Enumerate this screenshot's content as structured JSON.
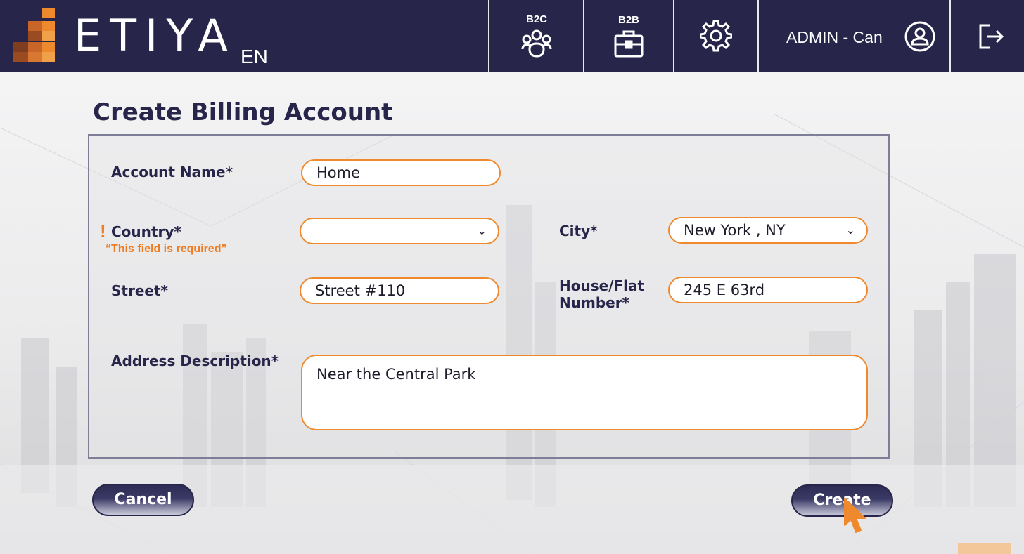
{
  "header": {
    "brand": "ETIYA",
    "language": "EN",
    "b2c_label": "B2C",
    "b2b_label": "B2B",
    "user": "ADMIN - Can",
    "icons": [
      "users-icon",
      "briefcase-icon",
      "gear-icon",
      "user-circle-icon",
      "logout-icon"
    ]
  },
  "page": {
    "title": "Create Billing Account"
  },
  "form": {
    "account_name": {
      "label": "Account Name*",
      "value": "Home"
    },
    "country": {
      "label": "Country*",
      "value": "",
      "error": "“This field is required”",
      "error_mark": "!"
    },
    "city": {
      "label": "City*",
      "value": "New York , NY"
    },
    "street": {
      "label": "Street*",
      "value": "Street #110"
    },
    "house": {
      "label_line1": "House/Flat",
      "label_line2": "Number*",
      "value": "245 E 63rd"
    },
    "address_description": {
      "label": "Address Description*",
      "value": "Near the Central Park"
    }
  },
  "actions": {
    "cancel": "Cancel",
    "create": "Create"
  },
  "colors": {
    "header_bg": "#27264a",
    "accent": "#ee8a2d",
    "error": "#ef7c22"
  }
}
